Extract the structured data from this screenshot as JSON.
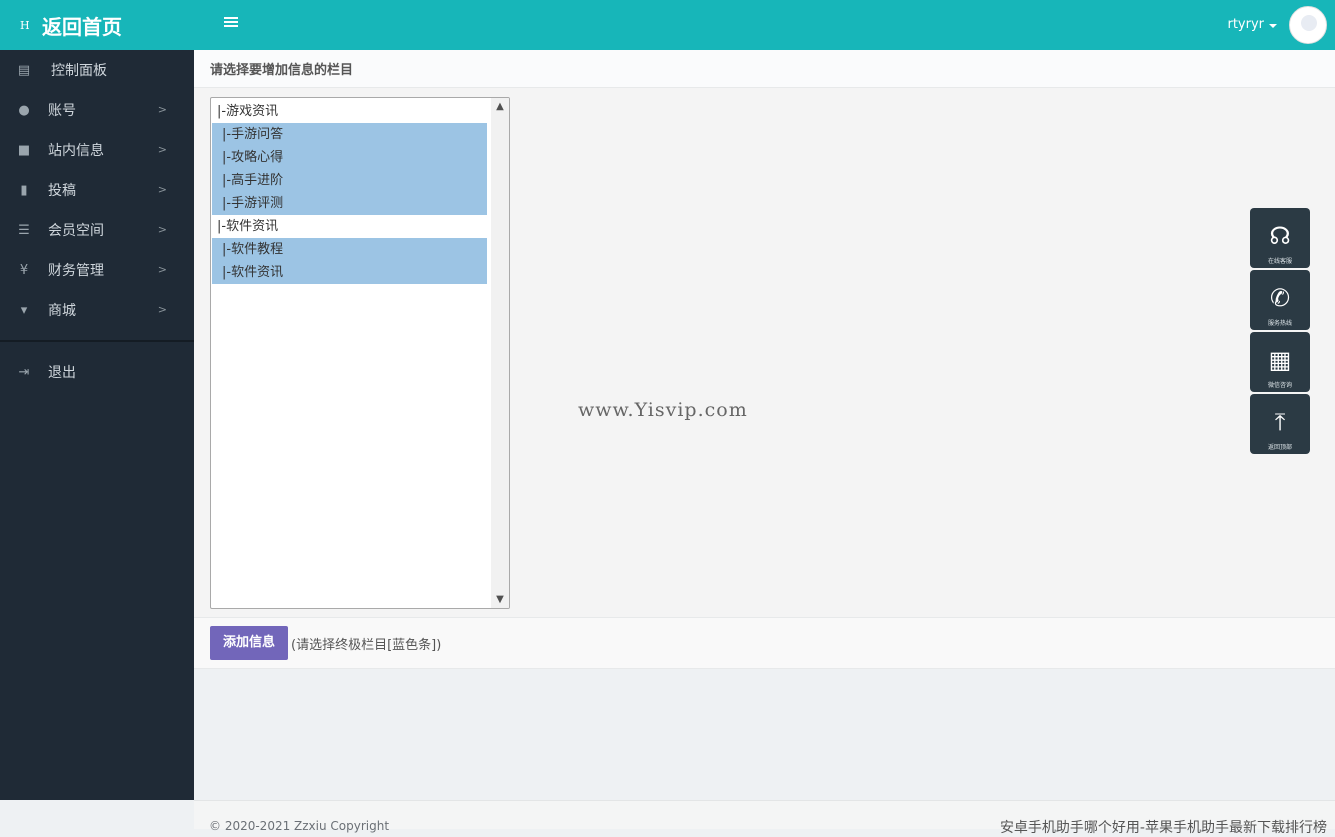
{
  "header": {
    "brand_icon": "H",
    "brand_title": "返回首页",
    "username": "rtyryr"
  },
  "sidebar": {
    "items": [
      {
        "label": "控制面板",
        "icon": "dashboard-icon",
        "glyph": "▤"
      },
      {
        "label": "账号",
        "icon": "user-icon",
        "glyph": "●"
      },
      {
        "label": "站内信息",
        "icon": "comment-icon",
        "glyph": "■"
      },
      {
        "label": "投稿",
        "icon": "file-icon",
        "glyph": "▮"
      },
      {
        "label": "会员空间",
        "icon": "list-icon",
        "glyph": "☰"
      },
      {
        "label": "财务管理",
        "icon": "yen-icon",
        "glyph": "¥"
      },
      {
        "label": "商城",
        "icon": "cart-icon",
        "glyph": "▾"
      },
      {
        "label": "退出",
        "icon": "logout-icon",
        "glyph": "⇥"
      }
    ]
  },
  "panel": {
    "title": "请选择要增加信息的栏目",
    "options": [
      {
        "label": "|-游戏资讯",
        "selected": false
      },
      {
        "label": "|-手游问答",
        "selected": true
      },
      {
        "label": "|-攻略心得",
        "selected": true
      },
      {
        "label": "|-高手进阶",
        "selected": true
      },
      {
        "label": "|-手游评测",
        "selected": true
      },
      {
        "label": "|-软件资讯",
        "selected": false
      },
      {
        "label": "|-软件教程",
        "selected": true
      },
      {
        "label": "|-软件资讯",
        "selected": true
      }
    ],
    "watermark": "www.Yisvip.com",
    "add_button": "添加信息",
    "hint": "(请选择终极栏目[蓝色条])"
  },
  "float_buttons": [
    {
      "caption": "在线客服",
      "icon": "headset-icon",
      "glyph": "☊"
    },
    {
      "caption": "服务热线",
      "icon": "phone-icon",
      "glyph": "✆"
    },
    {
      "caption": "微信咨询",
      "icon": "qrcode-icon",
      "glyph": "▦"
    },
    {
      "caption": "返回顶部",
      "icon": "arrow-up-icon",
      "glyph": "⤒"
    }
  ],
  "footer": {
    "copyright": "© 2020-2021 Zzxiu Copyright",
    "link": "安卓手机助手哪个好用-苹果手机助手最新下载排行榜"
  },
  "colors": {
    "topbar": "#17b6b9",
    "sidebar": "#1f2a36",
    "selected_option": "#9cc4e4",
    "add_button": "#7266ba",
    "float_button": "#2b3a44"
  }
}
